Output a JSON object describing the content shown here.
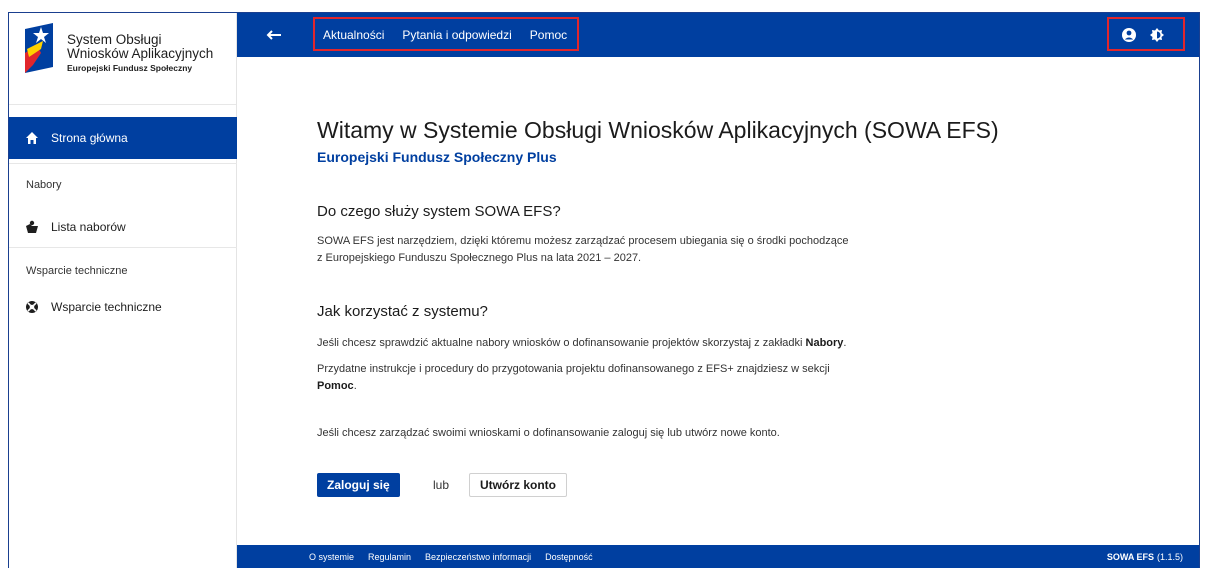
{
  "sidebar": {
    "logo": {
      "line1": "System Obsługi",
      "line2": "Wniosków Aplikacyjnych",
      "line3": "Europejski Fundusz Społeczny"
    },
    "home_label": "Strona główna",
    "section_nabory": "Nabory",
    "item_lista": "Lista naborów",
    "section_wsparcie": "Wsparcie techniczne",
    "item_wsparcie": "Wsparcie techniczne"
  },
  "header": {
    "nav": [
      "Aktualności",
      "Pytania i odpowiedzi",
      "Pomoc"
    ]
  },
  "main": {
    "title": "Witamy w Systemie Obsługi Wniosków Aplikacyjnych (SOWA EFS)",
    "subtitle": "Europejski Fundusz Społeczny Plus",
    "section1_title": "Do czego służy system SOWA EFS?",
    "section1_line1": "SOWA EFS jest narzędziem, dzięki któremu możesz zarządzać procesem ubiegania się o środki pochodzące",
    "section1_line2": "z Europejskiego Funduszu Społecznego Plus na lata 2021 – 2027.",
    "section2_title": "Jak korzystać z systemu?",
    "p1_text": "Jeśli chcesz sprawdzić aktualne nabory wniosków o dofinansowanie projektów skorzystaj z zakładki ",
    "p1_bold": "Nabory",
    "p1_end": ".",
    "p2_line1": "Przydatne instrukcje i procedury do przygotowania projektu dofinansowanego z EFS+ znajdziesz w sekcji",
    "p2_bold": "Pomoc",
    "p2_end": ".",
    "p3": "Jeśli chcesz zarządzać swoimi wnioskami o dofinansowanie zaloguj się lub utwórz nowe konto.",
    "login_label": "Zaloguj się",
    "or_label": "lub",
    "register_label": "Utwórz konto"
  },
  "footer": {
    "links": [
      "O systemie",
      "Regulamin",
      "Bezpieczeństwo informacji",
      "Dostępność"
    ],
    "app_name": "SOWA EFS",
    "version": "(1.1.5)"
  },
  "colors": {
    "primary": "#003fa0",
    "highlight": "#e1262c"
  },
  "icons": {
    "back": "arrow-left-icon",
    "user": "user-circle-icon",
    "contrast": "contrast-icon",
    "home": "home-icon",
    "list": "clipboard-icon",
    "support": "lifebuoy-icon"
  }
}
